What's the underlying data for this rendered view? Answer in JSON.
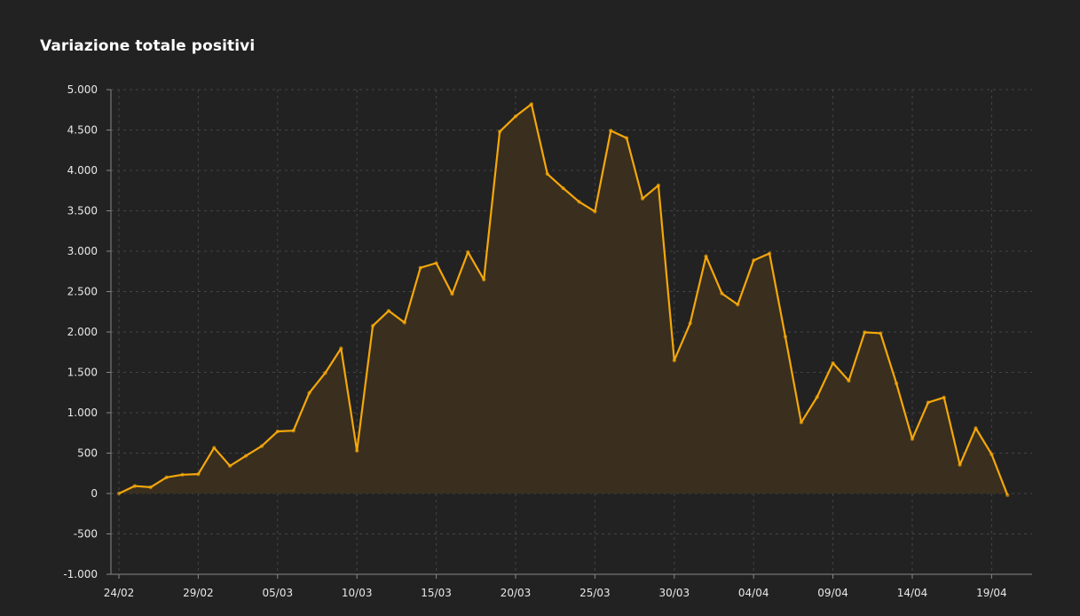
{
  "chart_data": {
    "type": "area",
    "title": "Variazione totale positivi",
    "xlabel": "",
    "ylabel": "",
    "ylim": [
      -1000,
      5000
    ],
    "y_ticks": [
      5000,
      4500,
      4000,
      3500,
      3000,
      2500,
      2000,
      1500,
      1000,
      500,
      0,
      -500,
      -1000
    ],
    "y_tick_labels": [
      "5.000",
      "4.500",
      "4.000",
      "3.500",
      "3.000",
      "2.500",
      "2.000",
      "1.500",
      "1.000",
      "500",
      "0",
      "-500",
      "-1.000"
    ],
    "x_tick_labels": [
      "24/02",
      "29/02",
      "05/03",
      "10/03",
      "15/03",
      "20/03",
      "25/03",
      "30/03",
      "04/04",
      "09/04",
      "14/04",
      "19/04"
    ],
    "x_tick_every": 5,
    "grid": true,
    "legend": "none",
    "colors": {
      "line": "#f5a70a",
      "fill": "#3a2f1e",
      "background": "#222222",
      "grid": "#444444",
      "axis": "#888888",
      "text": "#e8e8e8",
      "title": "#ffffff"
    },
    "x": [
      "24/02",
      "25/02",
      "26/02",
      "27/02",
      "28/02",
      "29/02",
      "01/03",
      "02/03",
      "03/03",
      "04/03",
      "05/03",
      "06/03",
      "07/03",
      "08/03",
      "09/03",
      "10/03",
      "11/03",
      "12/03",
      "13/03",
      "14/03",
      "15/03",
      "16/03",
      "17/03",
      "18/03",
      "19/03",
      "20/03",
      "21/03",
      "22/03",
      "23/03",
      "24/03",
      "25/03",
      "26/03",
      "27/03",
      "28/03",
      "29/03",
      "30/03",
      "31/03",
      "01/04",
      "02/04",
      "03/04",
      "04/04",
      "05/04",
      "06/04",
      "07/04",
      "08/04",
      "09/04",
      "10/04",
      "11/04",
      "12/04",
      "13/04",
      "14/04",
      "15/04",
      "16/04",
      "17/04",
      "18/04",
      "19/04",
      "20/04"
    ],
    "series": [
      {
        "values": [
          0,
          93,
          78,
          200,
          233,
          240,
          566,
          342,
          466,
          587,
          769,
          778,
          1247,
          1492,
          1797,
          529,
          2076,
          2262,
          2116,
          2795,
          2853,
          2470,
          2989,
          2648,
          4480,
          4670,
          4821,
          3957,
          3780,
          3612,
          3491,
          4492,
          4401,
          3651,
          3815,
          1648,
          2107,
          2937,
          2477,
          2339,
          2886,
          2972,
          1941,
          880,
          1195,
          1615,
          1396,
          1996,
          1984,
          1363,
          675,
          1127,
          1189,
          355,
          809,
          486,
          -20
        ]
      }
    ]
  }
}
